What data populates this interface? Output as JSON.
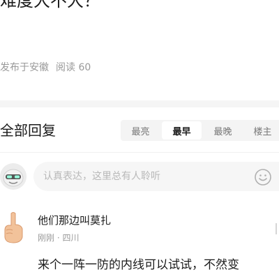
{
  "post": {
    "title": "难度大不大？",
    "location": "发布于安徽",
    "reads": "阅读 60"
  },
  "replies": {
    "title": "全部回复",
    "sort_tabs": [
      {
        "label": "最亮",
        "active": false
      },
      {
        "label": "最早",
        "active": true
      },
      {
        "label": "最晚",
        "active": false
      },
      {
        "label": "楼主",
        "active": false
      }
    ]
  },
  "composer": {
    "avatar": "user-avatar-icon",
    "placeholder": "认真表达，这里总有人聆听",
    "emoji": "smiley-icon"
  },
  "comments": [
    {
      "author": "他们那边叫莫扎",
      "meta": "刚刚 · 四川",
      "body": "来个一阵一防的内线可以试试，不然变",
      "avatar": "hand-avatar-icon"
    }
  ],
  "colors": {
    "text_primary": "#1a1a1a",
    "text_secondary": "#999999",
    "tab_bg": "#f4f4f4",
    "band": "#f5f5f5"
  }
}
